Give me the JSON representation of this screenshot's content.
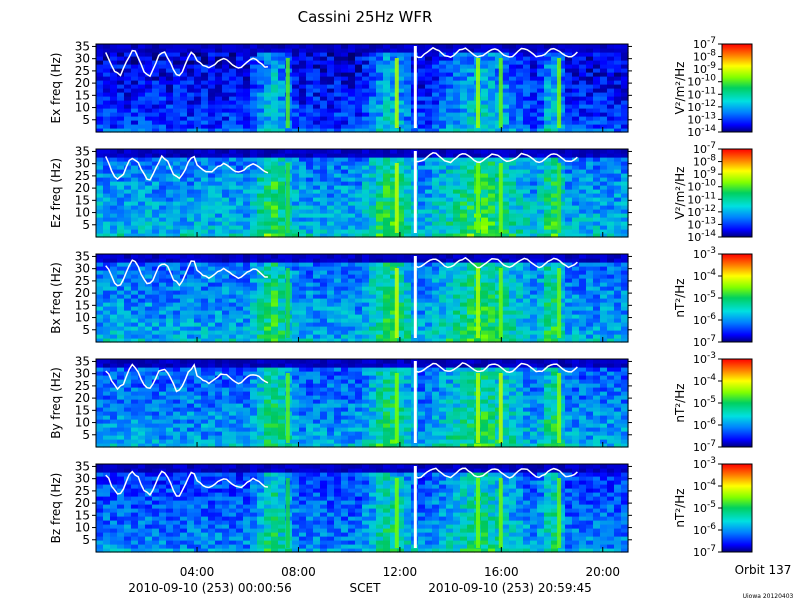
{
  "title": "Cassini 25Hz WFR",
  "time_axis": {
    "ticks": [
      "04:00",
      "08:00",
      "12:00",
      "16:00",
      "20:00"
    ],
    "start": "2010-09-10 (253) 00:00:56",
    "label": "SCET",
    "end": "2010-09-10 (253) 20:59:45"
  },
  "orbit": "Orbit 137",
  "credit": "Uiowa 20120403",
  "chart_data": [
    {
      "type": "heatmap",
      "ylabel": "Ex freq (Hz)",
      "yticks": [
        5,
        10,
        15,
        20,
        25,
        30,
        35
      ],
      "ylim": [
        0,
        36
      ],
      "xlim": [
        "00:00:56",
        "20:59:45"
      ],
      "colorbar": {
        "label": "V²/m²/Hz",
        "scale": "log",
        "tick_labels": [
          "10^-7",
          "10^-8",
          "10^-9",
          "10^-10",
          "10^-11",
          "10^-12",
          "10^-13",
          "10^-14"
        ]
      }
    },
    {
      "type": "heatmap",
      "ylabel": "Ez freq (Hz)",
      "yticks": [
        5,
        10,
        15,
        20,
        25,
        30,
        35
      ],
      "ylim": [
        0,
        36
      ],
      "xlim": [
        "00:00:56",
        "20:59:45"
      ],
      "colorbar": {
        "label": "V²/m²/Hz",
        "scale": "log",
        "tick_labels": [
          "10^-7",
          "10^-8",
          "10^-9",
          "10^-10",
          "10^-11",
          "10^-12",
          "10^-13",
          "10^-14"
        ]
      }
    },
    {
      "type": "heatmap",
      "ylabel": "Bx freq (Hz)",
      "yticks": [
        5,
        10,
        15,
        20,
        25,
        30,
        35
      ],
      "ylim": [
        0,
        36
      ],
      "xlim": [
        "00:00:56",
        "20:59:45"
      ],
      "colorbar": {
        "label": "nT²/Hz",
        "scale": "log",
        "tick_labels": [
          "10^-3",
          "10^-4",
          "10^-5",
          "10^-6",
          "10^-7"
        ]
      }
    },
    {
      "type": "heatmap",
      "ylabel": "By freq (Hz)",
      "yticks": [
        5,
        10,
        15,
        20,
        25,
        30,
        35
      ],
      "ylim": [
        0,
        36
      ],
      "xlim": [
        "00:00:56",
        "20:59:45"
      ],
      "colorbar": {
        "label": "nT²/Hz",
        "scale": "log",
        "tick_labels": [
          "10^-3",
          "10^-4",
          "10^-5",
          "10^-6",
          "10^-7"
        ]
      }
    },
    {
      "type": "heatmap",
      "ylabel": "Bz freq (Hz)",
      "yticks": [
        5,
        10,
        15,
        20,
        25,
        30,
        35
      ],
      "ylim": [
        0,
        36
      ],
      "xlim": [
        "00:00:56",
        "20:59:45"
      ],
      "colorbar": {
        "label": "nT²/Hz",
        "scale": "log",
        "tick_labels": [
          "10^-3",
          "10^-4",
          "10^-5",
          "10^-6",
          "10^-7"
        ]
      }
    }
  ],
  "colors": {
    "background": "#ffffff",
    "text": "#000000",
    "trace": "#ffffff"
  }
}
